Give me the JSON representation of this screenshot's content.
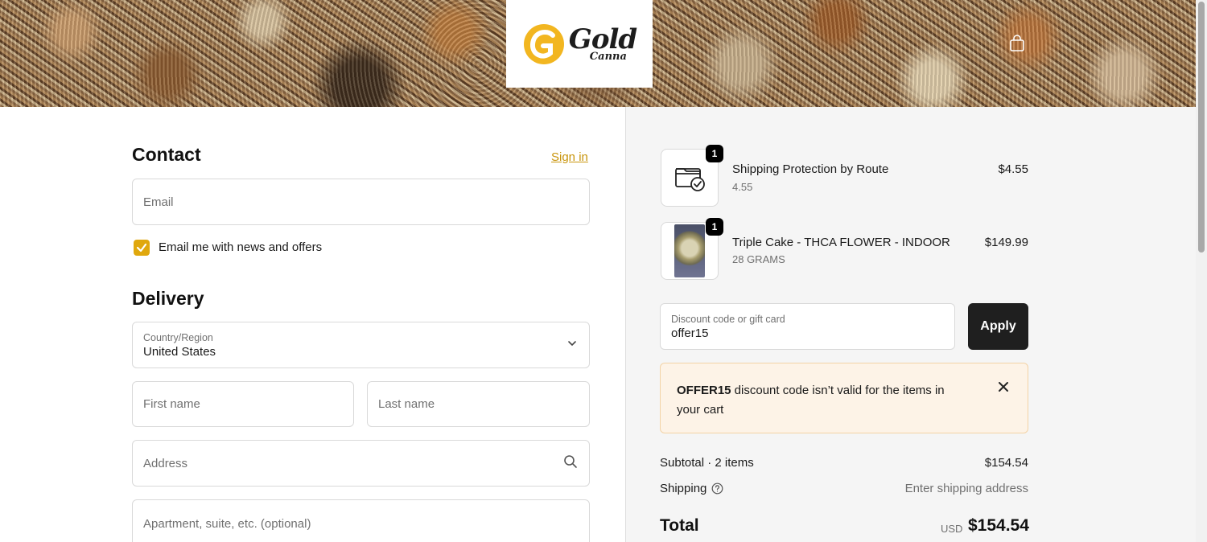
{
  "header": {
    "logo_text": "Gold",
    "logo_subtext": "Canna",
    "cart_icon": "bag-icon"
  },
  "contact": {
    "title": "Contact",
    "sign_in_label": "Sign in",
    "email_placeholder": "Email",
    "newsletter_label": "Email me with news and offers",
    "newsletter_checked": true
  },
  "delivery": {
    "title": "Delivery",
    "country_label": "Country/Region",
    "country_value": "United States",
    "first_name_placeholder": "First name",
    "last_name_placeholder": "Last name",
    "address_placeholder": "Address",
    "apartment_placeholder": "Apartment, suite, etc. (optional)"
  },
  "cart": {
    "items": [
      {
        "name": "Shipping Protection by Route",
        "variant": "4.55",
        "price": "$4.55",
        "quantity": "1",
        "icon": "shipping-protection-icon"
      },
      {
        "name": "Triple Cake - THCA FLOWER - INDOOR",
        "variant": "28 GRAMS",
        "price": "$149.99",
        "quantity": "1",
        "icon": "product-image"
      }
    ],
    "discount_label": "Discount code or gift card",
    "discount_value": "offer15",
    "apply_label": "Apply",
    "notice_code": "OFFER15",
    "notice_text": " discount code isn’t valid for the items in your cart",
    "subtotal_label": "Subtotal · 2 items",
    "subtotal_value": "$154.54",
    "shipping_label": "Shipping",
    "shipping_value": "Enter shipping address",
    "total_label": "Total",
    "total_currency": "USD",
    "total_value": "$154.54"
  },
  "colors": {
    "accent": "#e0a80d",
    "link": "#c8940a",
    "notice_bg": "#fdf3e7",
    "button_dark": "#1f1f1f"
  }
}
